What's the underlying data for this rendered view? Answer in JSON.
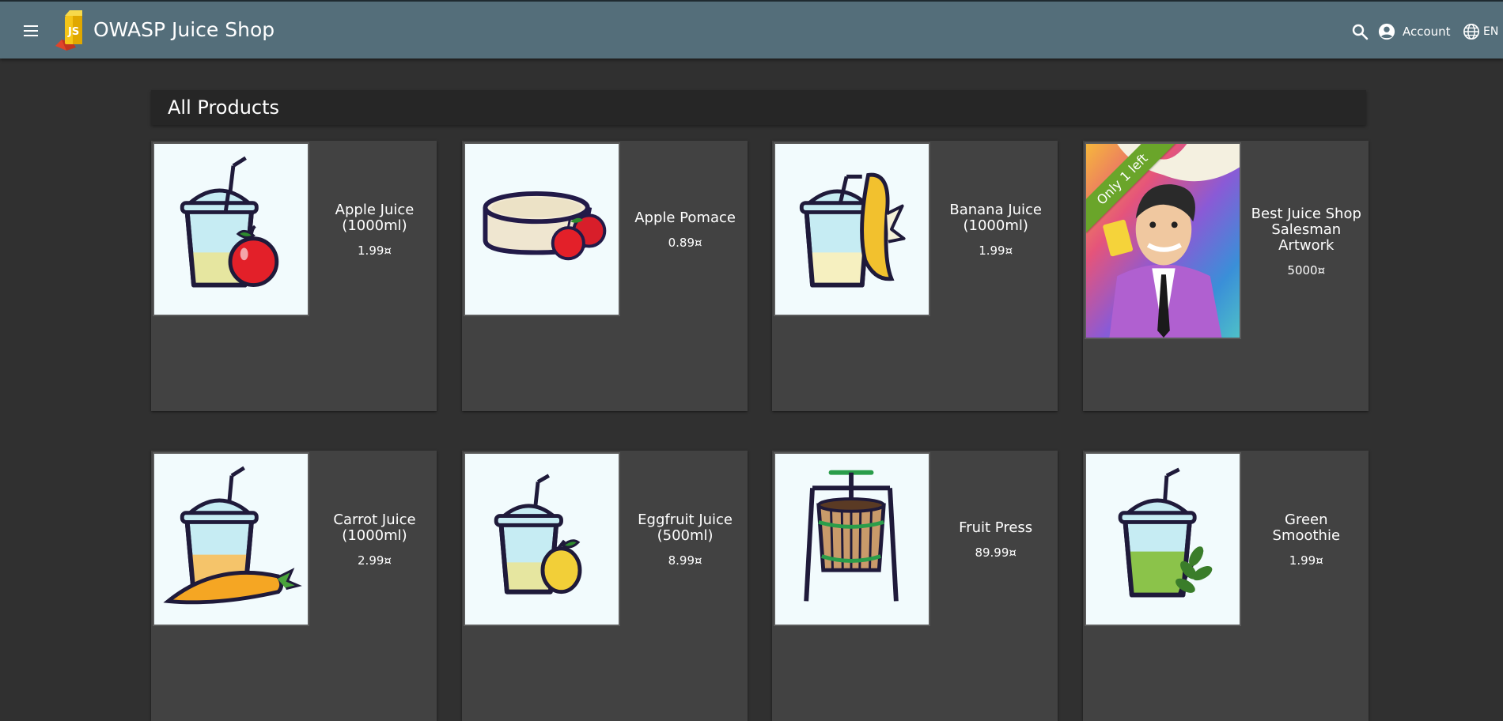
{
  "header": {
    "app_title": "OWASP Juice Shop",
    "account_label": "Account",
    "language_label": "EN",
    "toolbar_color": "#546e7a"
  },
  "main": {
    "heading": "All Products"
  },
  "products": [
    {
      "name": "Apple Juice (1000ml)",
      "price": "1.99¤",
      "image": "apple-juice-image"
    },
    {
      "name": "Apple Pomace",
      "price": "0.89¤",
      "image": "apple-pomace-image"
    },
    {
      "name": "Banana Juice (1000ml)",
      "price": "1.99¤",
      "image": "banana-juice-image"
    },
    {
      "name": "Best Juice Shop Salesman Artwork",
      "price": "5000¤",
      "image": "salesman-artwork-image",
      "ribbon": "Only 1 left",
      "ribbon_color": "#6aa52a"
    },
    {
      "name": "Carrot Juice (1000ml)",
      "price": "2.99¤",
      "image": "carrot-juice-image"
    },
    {
      "name": "Eggfruit Juice (500ml)",
      "price": "8.99¤",
      "image": "eggfruit-juice-image"
    },
    {
      "name": "Fruit Press",
      "price": "89.99¤",
      "image": "fruit-press-image"
    },
    {
      "name": "Green Smoothie",
      "price": "1.99¤",
      "image": "green-smoothie-image"
    }
  ]
}
